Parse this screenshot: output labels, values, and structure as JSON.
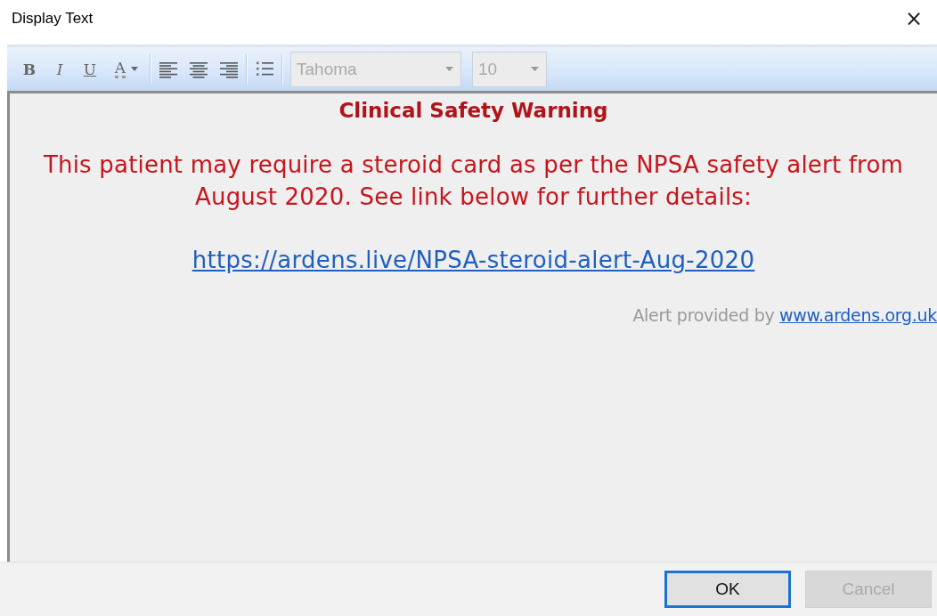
{
  "window": {
    "title": "Display Text",
    "close": "×"
  },
  "toolbar": {
    "buttons": [
      {
        "kind": "bold",
        "label": "B"
      },
      {
        "kind": "italic",
        "label": "I"
      },
      {
        "kind": "underline",
        "label": "U"
      },
      {
        "kind": "color",
        "label": "A"
      },
      {
        "kind": "sep"
      },
      {
        "kind": "align-left"
      },
      {
        "kind": "align-center"
      },
      {
        "kind": "align-right"
      },
      {
        "kind": "sep"
      },
      {
        "kind": "list"
      },
      {
        "kind": "sep"
      }
    ],
    "font": {
      "value": "Tahoma",
      "disabled": true
    },
    "size": {
      "value": "10",
      "disabled": true
    }
  },
  "content": {
    "heading": "Clinical Safety Warning",
    "message": "This patient may require a steroid card as per the NPSA safety alert from August 2020. See link below for further details:",
    "link": "https://ardens.live/NPSA-steroid-alert-Aug-2020",
    "footer_text": "Alert provided by ",
    "footer_link": "www.ardens.org.uk"
  },
  "buttons": [
    {
      "label": "OK",
      "default": true,
      "disabled": false
    },
    {
      "label": "Cancel",
      "default": false,
      "disabled": true
    }
  ]
}
